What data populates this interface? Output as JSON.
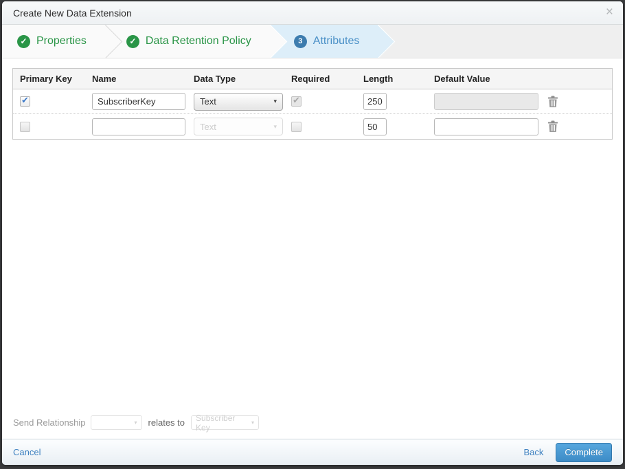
{
  "modal": {
    "title": "Create New Data Extension"
  },
  "icons": {
    "close": "×",
    "check": "✓",
    "caret_down": "▾"
  },
  "steps": [
    {
      "label": "Properties",
      "status": "complete"
    },
    {
      "label": "Data Retention Policy",
      "status": "complete"
    },
    {
      "label": "Attributes",
      "status": "active",
      "number": "3"
    }
  ],
  "table": {
    "headers": [
      "Primary Key",
      "Name",
      "Data Type",
      "Required",
      "Length",
      "Default Value"
    ],
    "rows": [
      {
        "primary_key": true,
        "name": "SubscriberKey",
        "data_type": "Text",
        "data_type_enabled": true,
        "required": true,
        "required_enabled": false,
        "length": "250",
        "default_value": "",
        "default_enabled": false
      },
      {
        "primary_key": false,
        "name": "",
        "data_type": "Text",
        "data_type_enabled": false,
        "required": false,
        "required_enabled": true,
        "length": "50",
        "default_value": "",
        "default_enabled": true
      }
    ]
  },
  "send_relationship": {
    "label": "Send Relationship",
    "relates_label": "relates to",
    "target_value": "Subscriber Key"
  },
  "footer": {
    "cancel_label": "Cancel",
    "back_label": "Back",
    "complete_label": "Complete"
  },
  "colors": {
    "step_complete_green": "#2a9547",
    "step_active_blue": "#4a90c7",
    "step_active_bg": "#ddeef9",
    "complete_button_blue": "#3d8bc6",
    "link_blue": "#3e81c0"
  }
}
